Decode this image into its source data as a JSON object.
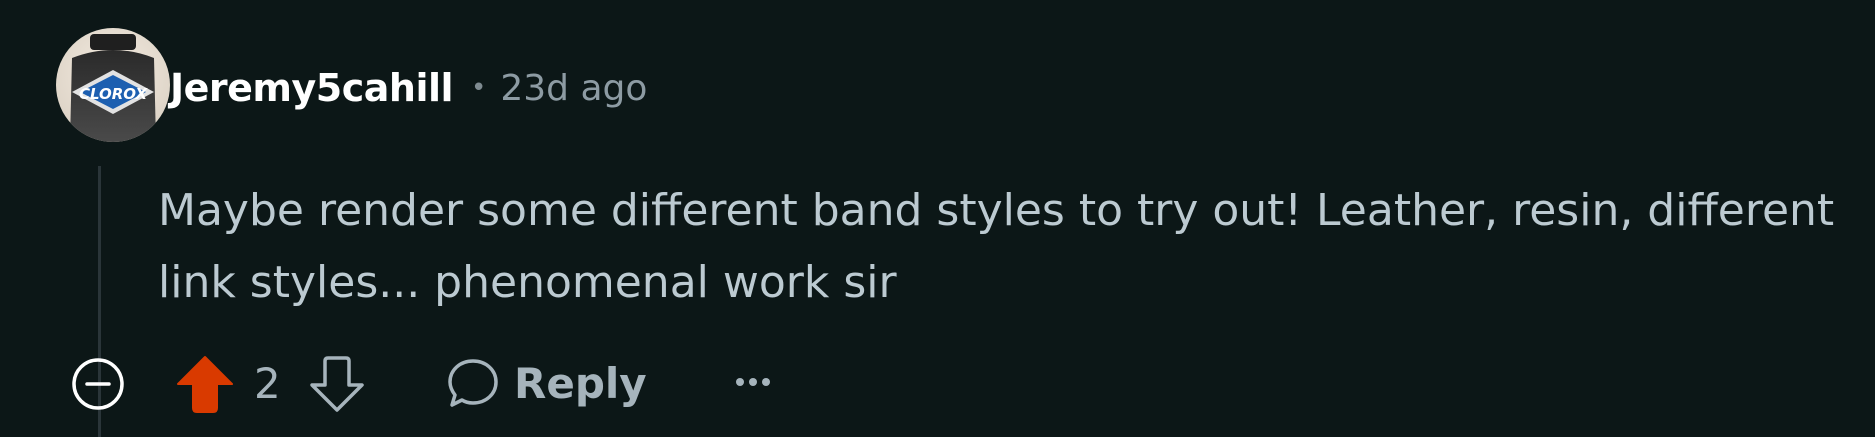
{
  "comment": {
    "author": "Jeremy5cahill",
    "separator": "•",
    "age": "23d ago",
    "body": "Maybe render some different band styles to try out! Leather, resin, different link styles... phenomenal work sir",
    "score": "2",
    "avatar_logo_text": "CLOROX"
  },
  "actions": {
    "reply_label": "Reply",
    "collapse_icon": "minus-circle-icon",
    "upvote_icon": "arrow-up-icon",
    "downvote_icon": "arrow-down-icon",
    "reply_icon": "speech-bubble-icon",
    "more_icon": "ellipsis-icon"
  },
  "colors": {
    "background": "#0c1717",
    "upvote_active": "#d93a00",
    "username": "#ffffff",
    "muted_text": "#8d9ba3"
  }
}
